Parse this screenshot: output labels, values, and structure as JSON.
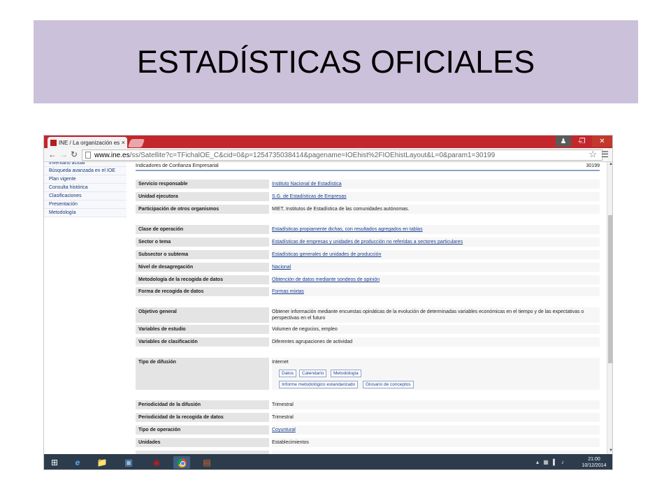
{
  "slide": {
    "title": "ESTADÍSTICAS OFICIALES"
  },
  "browser": {
    "tab_title": "INE / La organización esta",
    "tab_close": "×",
    "url_host": "www.ine.es",
    "url_path": "/ss/Satellite?c=TFichalOE_C&cid=0&p=1254735038414&pagename=IOEhist%2FIOEhistLayout&L=0&param1=30199"
  },
  "sidebar": {
    "items": [
      "Inventario actual",
      "Búsqueda avanzada en el IOE",
      "Plan vigente",
      "Consulta histórica",
      "Clasificaciones",
      "Presentación",
      "Metodología"
    ]
  },
  "record": {
    "title": "Indicadores de Confianza Empresarial",
    "code": "30199",
    "servicio_label": "Servicio responsable",
    "servicio_value": "Instituto Nacional de Estadística",
    "unidad_label": "Unidad ejecutora",
    "unidad_value": "S.G. de Estadísticas de Empresas",
    "participacion_label": "Participación de otros organismos",
    "participacion_value": "MIET, Institutos de Estadística de las comunidades autónomas.",
    "clase_label": "Clase de operación",
    "clase_value": "Estadísticas propiamente dichas, con resultados agregados en tablas",
    "sector_label": "Sector o tema",
    "sector_value": "Estadísticas de empresas y unidades de producción no referidas a sectores particulares",
    "subsector_label": "Subsector o subtema",
    "subsector_value": "Estadísticas generales de unidades de producción",
    "nivel_label": "Nivel de desagregación",
    "nivel_value": "Nacional",
    "metodologia_label": "Metodología de la recogida de datos",
    "metodologia_value": "Obtención de datos mediante sondeos de opinión",
    "forma_label": "Forma de recogida de datos",
    "forma_value": "Formas mixtas",
    "objetivo_label": "Objetivo general",
    "objetivo_value": "Obtener información mediante encuestas opináticas de la evolución de determinadas variables económicas en el tiempo y de las expectativas o perspectivas en el futuro",
    "variables_estudio_label": "Variables de estudio",
    "variables_estudio_value": "Volumen de negocios, empleo",
    "variables_clas_label": "Variables de clasificación",
    "variables_clas_value": "Diferentes agrupaciones de actividad",
    "difusion_label": "Tipo de difusión",
    "difusion_value": "Internet",
    "btn_datos": "Datos",
    "btn_calendario": "Calendario",
    "btn_metodologia": "Metodología",
    "btn_informe": "Informe metodológico estandarizado",
    "btn_glosario": "Glosario de conceptos",
    "periodicidad_dif_label": "Periodicidad de la difusión",
    "periodicidad_dif_value": "Trimestral",
    "periodicidad_rec_label": "Periodicidad de la recogida de datos",
    "periodicidad_rec_value": "Trimestral",
    "tipo_op_label": "Tipo de operación",
    "tipo_op_value": "Coyuntural",
    "unidades_label": "Unidades",
    "unidades_value": "Establecimientos"
  },
  "taskbar": {
    "time": "21:00",
    "date": "10/12/2014"
  }
}
